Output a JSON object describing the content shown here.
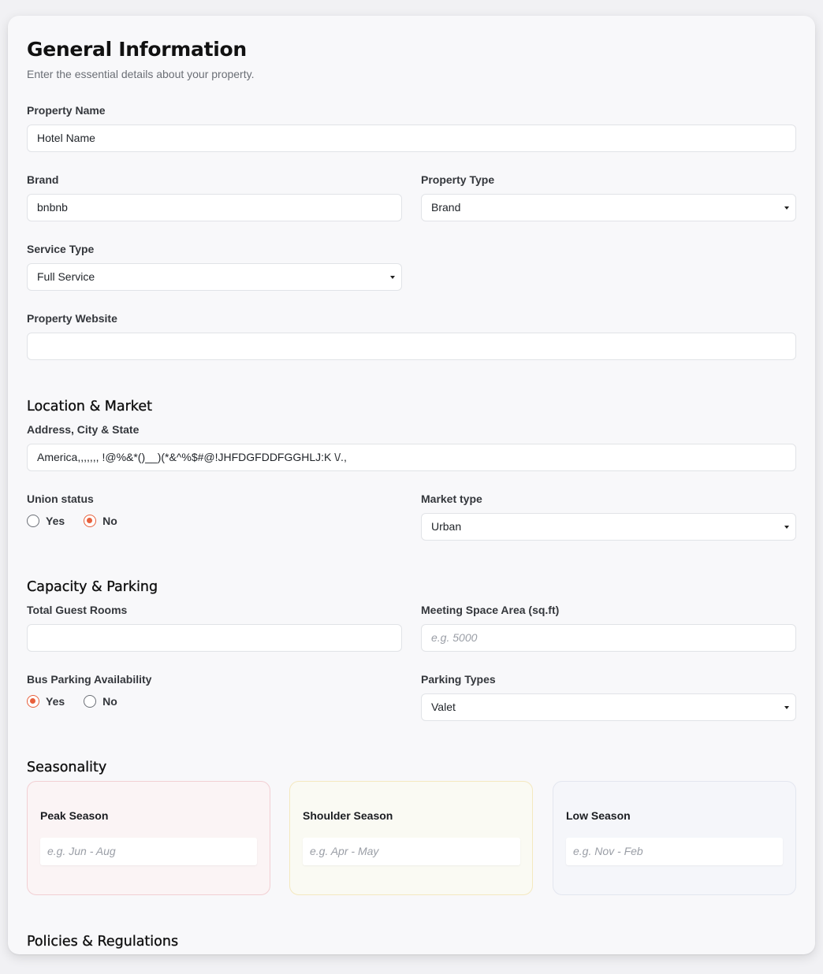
{
  "header": {
    "title": "General Information",
    "subtitle": "Enter the essential details about your property."
  },
  "general": {
    "property_name": {
      "label": "Property Name",
      "value": "Hotel Name"
    },
    "brand": {
      "label": "Brand",
      "value": "bnbnb"
    },
    "property_type": {
      "label": "Property Type",
      "value": "Brand"
    },
    "service_type": {
      "label": "Service Type",
      "value": "Full Service"
    },
    "property_website": {
      "label": "Property Website",
      "value": ""
    }
  },
  "location": {
    "section_title": "Location & Market",
    "address": {
      "label": "Address, City & State",
      "value": "America,,,,,,, !@%&*()__)(*&^%$#@!JHFDGFDDFGGHLJ:K \\/.,"
    },
    "union_status": {
      "label": "Union status",
      "options": [
        "Yes",
        "No"
      ],
      "selected": "No"
    },
    "market_type": {
      "label": "Market type",
      "value": "Urban"
    }
  },
  "capacity": {
    "section_title": "Capacity & Parking",
    "total_rooms": {
      "label": "Total Guest Rooms",
      "value": ""
    },
    "meeting_space": {
      "label": "Meeting Space Area (sq.ft)",
      "placeholder": "e.g. 5000"
    },
    "bus_parking": {
      "label": "Bus Parking Availability",
      "options": [
        "Yes",
        "No"
      ],
      "selected": "Yes"
    },
    "parking_types": {
      "label": "Parking Types",
      "value": "Valet"
    }
  },
  "seasonality": {
    "section_title": "Seasonality",
    "peak": {
      "title": "Peak Season",
      "placeholder": "e.g. Jun - Aug"
    },
    "shoulder": {
      "title": "Shoulder Season",
      "placeholder": "e.g. Apr - May"
    },
    "low": {
      "title": "Low Season",
      "placeholder": "e.g. Nov - Feb"
    }
  },
  "policies": {
    "section_title": "Policies & Regulations"
  },
  "colors": {
    "accent": "#e8603c",
    "card_background": "#f8f8fa",
    "page_background": "#f1f1f4"
  },
  "icons": {
    "select_arrow": "caret-down-icon"
  }
}
